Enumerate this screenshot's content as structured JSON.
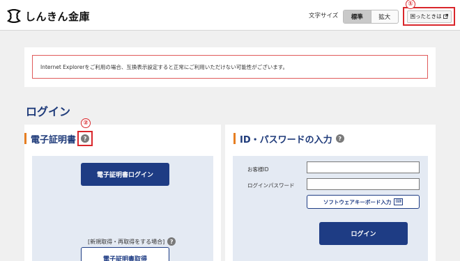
{
  "header": {
    "logo_text": "しんきん金庫",
    "font_size_label": "文字サイズ",
    "font_size_options": [
      "標準",
      "拡大"
    ],
    "help_label": "困ったときは"
  },
  "markers": [
    "①",
    "②"
  ],
  "notice": "Internet Explorerをご利用の場合、互換表示設定すると正常にご利用いただけない可能性がございます。",
  "page_title": "ログイン",
  "cert_section": {
    "title": "電子証明書",
    "help_mark": "?",
    "login_button": "電子証明書ログイン",
    "reacquire_text": "[新規取得・再取得をする場合]",
    "acquire_button": "電子証明書取得"
  },
  "id_section": {
    "title": "ID・パスワードの入力",
    "help_mark": "?",
    "customer_id_label": "お客様ID",
    "password_label": "ログインパスワード",
    "soft_keyboard_label": "ソフトウェアキーボード入力",
    "soft_keyboard_icon_text": "⌨",
    "login_button": "ログイン"
  },
  "colors": {
    "brand_blue": "#1e3c84",
    "title_blue": "#1f3b7a",
    "accent_orange": "#e67e22",
    "marker_red": "#d9262b",
    "panel_bg": "#e4eaf3"
  }
}
